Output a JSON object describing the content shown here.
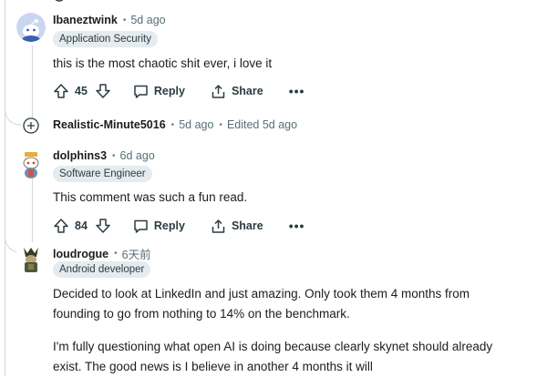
{
  "comments": [
    {
      "author": "Ibaneztwink",
      "time": "5d ago",
      "flair": "Application Security",
      "body": "this is the most chaotic shit ever, i love it",
      "votes": "45",
      "reply_label": "Reply",
      "share_label": "Share"
    },
    {
      "author": "Realistic-Minute5016",
      "time": "5d ago",
      "edited": "Edited 5d ago"
    },
    {
      "author": "dolphins3",
      "time": "6d ago",
      "flair": "Software Engineer",
      "body": "This comment was such a fun read.",
      "votes": "84",
      "reply_label": "Reply",
      "share_label": "Share"
    },
    {
      "author": "loudrogue",
      "time": "6天前",
      "flair": "Android developer",
      "body_lines": [
        "Decided to look at LinkedIn and just amazing. Only took them 4 months from",
        "founding to go from nothing to 14% on the benchmark.",
        "I'm fully questioning what open AI is doing because clearly skynet should already",
        "exist. The good news is I believe in another 4 months it will"
      ]
    }
  ],
  "colors": {
    "text": "#1c1c1c",
    "meta": "#576f76",
    "flair_bg": "#e5ebee",
    "thread": "#d4d8db"
  }
}
